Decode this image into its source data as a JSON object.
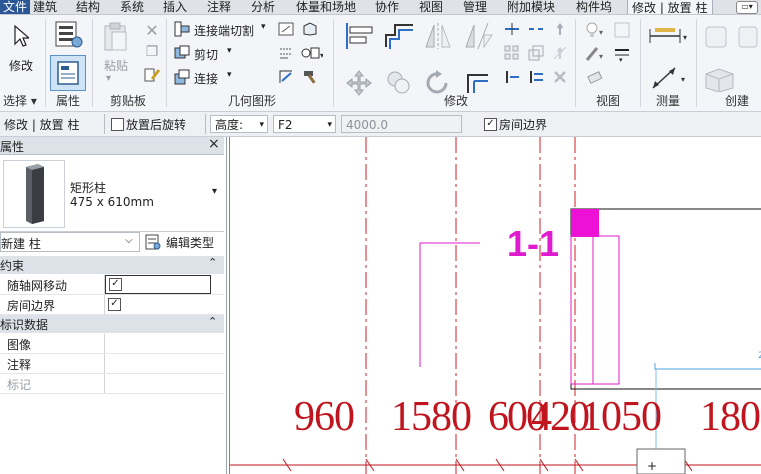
{
  "menubar": {
    "items": [
      "文件",
      "建筑",
      "结构",
      "系统",
      "插入",
      "注释",
      "分析",
      "体量和场地",
      "协作",
      "视图",
      "管理",
      "附加模块",
      "构件坞"
    ],
    "active_tab": "修改 | 放置 柱",
    "right_icon": "collapse-ribbon-icon"
  },
  "ribbon": {
    "modify_label": "修改",
    "groups": {
      "select": "选择",
      "properties": "属性",
      "clipboard": "剪贴板",
      "geometry": "几何图形",
      "modify": "修改",
      "view": "视图",
      "measure": "测量",
      "create": "创建"
    },
    "paste_label": "粘贴",
    "geometry_items": {
      "join_cut": "连接端切割",
      "cut": "剪切",
      "join": "连接"
    }
  },
  "optionsbar": {
    "context": "修改 | 放置 柱",
    "rotate_after_place": "放置后旋转",
    "height_label": "高度:",
    "height_value": "",
    "level_value": "F2",
    "offset_value": "4000.0",
    "room_bounding": "房间边界"
  },
  "properties": {
    "title": "属性",
    "close": "×",
    "family": "矩形柱",
    "type": "475 x 610mm",
    "instance_dropdown": "新建 柱",
    "edit_type": "编辑类型",
    "sections": [
      {
        "name": "约束",
        "rows": [
          {
            "label": "随轴网移动",
            "checked": true
          },
          {
            "label": "房间边界",
            "checked": true
          }
        ]
      },
      {
        "name": "标识数据",
        "rows": [
          {
            "label": "图像"
          },
          {
            "label": "注释"
          },
          {
            "label": "标记"
          }
        ]
      }
    ]
  },
  "drawing": {
    "section_tag": "1-1",
    "dimensions": [
      "960",
      "1580",
      "600",
      "420",
      "1050",
      "180"
    ],
    "colors": {
      "grid": "#d21f2a",
      "tag": "#e01bcf",
      "dim_text": "#c0141e",
      "blue": "#4aa3df"
    }
  }
}
